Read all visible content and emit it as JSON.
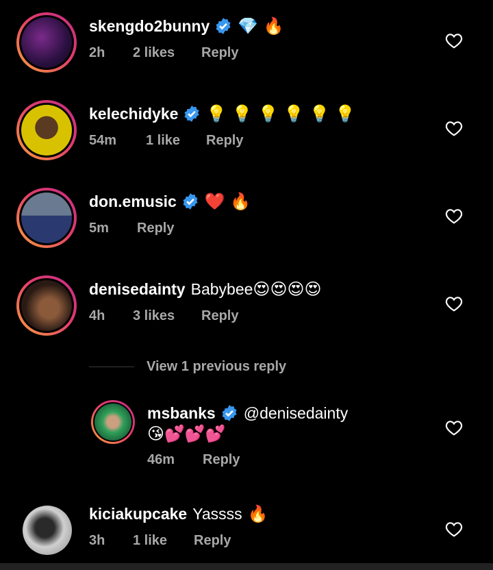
{
  "comments": [
    {
      "username": "skengdo2bunny",
      "verified": true,
      "text": "",
      "emoji": "💎 🔥",
      "time": "2h",
      "likes": "2 likes",
      "reply": "Reply"
    },
    {
      "username": "kelechidyke",
      "verified": true,
      "text": "",
      "emoji": "💡 💡 💡 💡 💡 💡",
      "time": "54m",
      "likes": "1 like",
      "reply": "Reply"
    },
    {
      "username": "don.emusic",
      "verified": true,
      "text": "",
      "emoji": "❤️ 🔥",
      "time": "5m",
      "likes": "",
      "reply": "Reply"
    },
    {
      "username": "denisedainty",
      "verified": false,
      "text": "Babybee",
      "emoji": "😍😍😍😍",
      "time": "4h",
      "likes": "3 likes",
      "reply": "Reply"
    }
  ],
  "view_replies": "View 1 previous reply",
  "reply_comment": {
    "username": "msbanks",
    "verified": true,
    "mention": "@denisedainty",
    "emoji": "😘💕💕💕",
    "time": "46m",
    "reply": "Reply"
  },
  "last_comment": {
    "username": "kiciakupcake",
    "text": "Yassss",
    "emoji": "🔥",
    "time": "3h",
    "likes": "1 like",
    "reply": "Reply"
  },
  "colors": {
    "background": "#000000",
    "meta_text": "#a8a8a8",
    "verified_badge": "#3897f0",
    "story_ring_start": "#f9a13b",
    "story_ring_end": "#c22d87"
  }
}
